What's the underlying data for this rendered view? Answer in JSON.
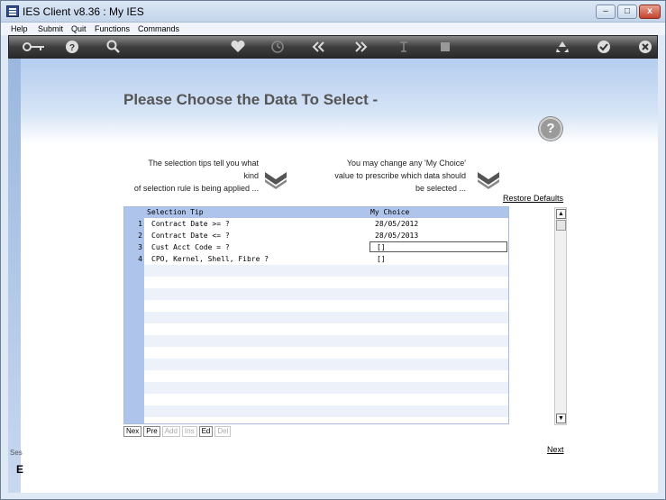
{
  "window": {
    "title": "IES Client v8.36 : My IES",
    "controls": {
      "minimize": "–",
      "maximize": "□",
      "close": "x"
    }
  },
  "menu": [
    "Help",
    "Submit",
    "Quit",
    "Functions",
    "Commands"
  ],
  "toolbar": {
    "icons": [
      "key-icon",
      "help-icon",
      "search-icon",
      "heart-icon",
      "clock-icon",
      "rewind-icon",
      "fast-forward-icon",
      "text-cursor-icon",
      "stop-icon",
      "recycle-icon",
      "check-icon",
      "close-icon"
    ]
  },
  "page": {
    "title": "Please Choose the Data To Select -",
    "help_glyph": "?",
    "tip_left": [
      "The selection tips tell you what kind",
      "of selection rule is being applied ..."
    ],
    "tip_right": [
      "You may change any 'My Choice'",
      "value to prescribe which data should",
      "be selected ..."
    ],
    "restore_defaults": "Restore Defaults",
    "next": "Next"
  },
  "grid": {
    "columns": [
      "Selection Tip",
      "My Choice"
    ],
    "rows": [
      {
        "num": "1",
        "tip": "Contract Date >= ?",
        "choice": "28/05/2012"
      },
      {
        "num": "2",
        "tip": "Contract Date <= ?",
        "choice": "28/05/2013"
      },
      {
        "num": "3",
        "tip": "Cust Acct Code = ?",
        "choice": "[]"
      },
      {
        "num": "4",
        "tip": "CPO, Kernel, Shell, Fibre ?",
        "choice": "[]"
      }
    ],
    "buttons": [
      {
        "label": "Nex",
        "enabled": true
      },
      {
        "label": "Pre",
        "enabled": true
      },
      {
        "label": "Add",
        "enabled": false
      },
      {
        "label": "Ins",
        "enabled": false
      },
      {
        "label": "Ed",
        "enabled": true
      },
      {
        "label": "Del",
        "enabled": false
      }
    ]
  },
  "sidebar": {
    "label": "Ses",
    "glyph": "E"
  }
}
